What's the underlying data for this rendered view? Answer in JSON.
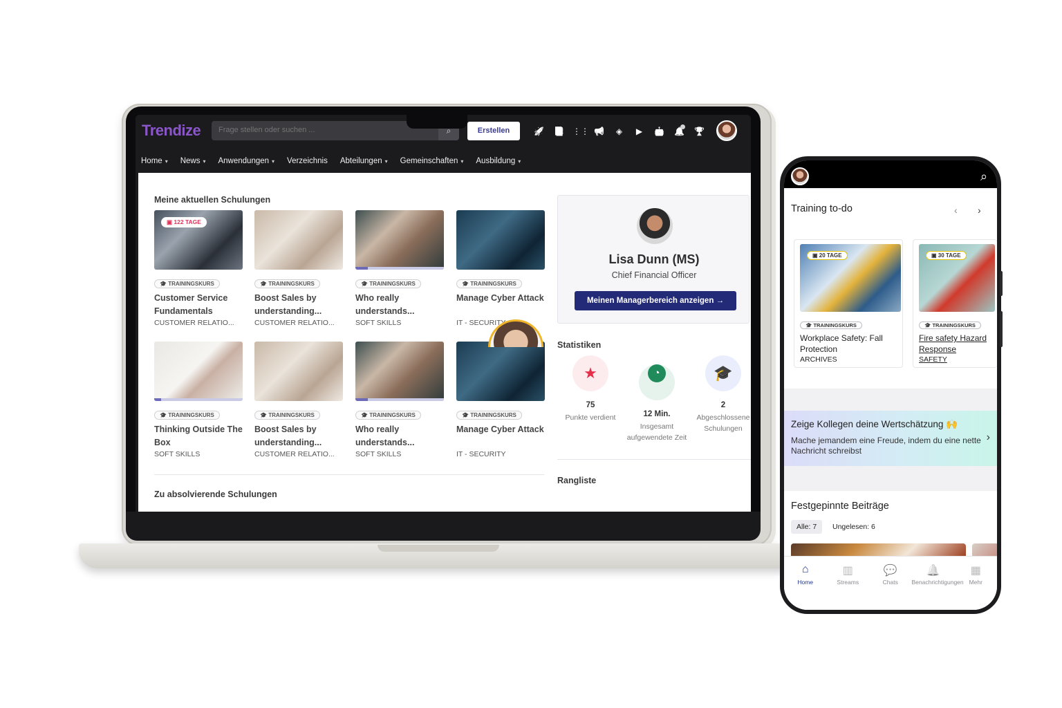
{
  "laptop": {
    "app": {
      "logo_text": "Trendize",
      "search_placeholder": "Frage stellen oder suchen ...",
      "create_label": "Erstellen",
      "top_icons": [
        "rocket-icon",
        "book-icon",
        "apps-grid-icon",
        "megaphone-icon",
        "layers-icon",
        "play-icon",
        "robot-icon",
        "bell-icon",
        "trophy-icon"
      ],
      "nav": [
        {
          "label": "Home",
          "has_dropdown": true
        },
        {
          "label": "News",
          "has_dropdown": true
        },
        {
          "label": "Anwendungen",
          "has_dropdown": true
        },
        {
          "label": "Verzeichnis",
          "has_dropdown": false
        },
        {
          "label": "Abteilungen",
          "has_dropdown": true
        },
        {
          "label": "Gemeinschaften",
          "has_dropdown": true
        },
        {
          "label": "Ausbildung",
          "has_dropdown": true
        }
      ]
    },
    "current_trainings": {
      "title": "Meine aktuellen Schulungen",
      "courses": [
        {
          "badge": "122 TAGE",
          "type": "TRAININGSKURS",
          "title": "Customer Service Fundamentals",
          "category": "CUSTOMER RELATIO...",
          "image": "people",
          "progress": 0
        },
        {
          "type": "TRAININGSKURS",
          "title": "Boost Sales by understanding...",
          "category": "CUSTOMER RELATIO...",
          "image": "shirts",
          "progress": 0
        },
        {
          "type": "TRAININGSKURS",
          "title": "Who really understands...",
          "category": "SOFT SKILLS",
          "image": "selfie",
          "progress": 0.14
        },
        {
          "type": "TRAININGSKURS",
          "title": "Manage Cyber Attack",
          "category": "IT - SECURITY",
          "image": "hacker",
          "progress": 0
        },
        {
          "type": "TRAININGSKURS",
          "title": "Thinking Outside The Box",
          "category": "SOFT SKILLS",
          "image": "thinker",
          "progress": 0.08
        },
        {
          "type": "TRAININGSKURS",
          "title": "Boost Sales by understanding...",
          "category": "CUSTOMER RELATIO...",
          "image": "shirts",
          "progress": 0
        },
        {
          "type": "TRAININGSKURS",
          "title": "Who really understands...",
          "category": "SOFT SKILLS",
          "image": "selfie",
          "progress": 0.14
        },
        {
          "type": "TRAININGSKURS",
          "title": "Manage Cyber Attack",
          "category": "IT - SECURITY",
          "image": "hacker",
          "progress": 0
        }
      ]
    },
    "to_complete": {
      "title": "Zu absolvierende Schulungen"
    },
    "profile": {
      "name": "Lisa Dunn (MS)",
      "role": "Chief Financial Officer",
      "manager_button": "Meinen Managerbereich anzeigen",
      "arrow": "→"
    },
    "stats": {
      "title": "Statistiken",
      "items": [
        {
          "icon": "star-icon",
          "glyph": "★",
          "color": "#e5304a",
          "bg": "#fdecee",
          "value": "75",
          "label": "Punkte verdient"
        },
        {
          "icon": "clock-icon",
          "glyph": "◷",
          "color": "#ffffff",
          "bg": "#e6f3ec",
          "value": "12 Min.",
          "label": "Insgesamt aufgewendete Zeit"
        },
        {
          "icon": "graduation-cap-icon",
          "glyph": "🎓",
          "color": "#2d4fd0",
          "bg": "#eaeefc",
          "value": "2",
          "label": "Abgeschlossene Schulungen"
        }
      ]
    },
    "leaderboard": {
      "title": "Rangliste"
    }
  },
  "phone": {
    "todo": {
      "title": "Training to-do",
      "prev": "‹",
      "next": "›",
      "courses": [
        {
          "badge": "20 TAGE",
          "type": "TRAININGSKURS",
          "title": "Workplace Safety: Fall Protection",
          "category": "ARCHIVES",
          "image": "worker"
        },
        {
          "badge": "30 TAGE",
          "type": "TRAININGSKURS",
          "title": "Fire safety Hazard Response",
          "category": "SAFETY",
          "image": "fire"
        }
      ]
    },
    "appreciation": {
      "title": "Zeige Kollegen deine Wertschätzung 🙌",
      "text": "Mache jemandem eine Freude, indem du eine nette Nachricht schreibst",
      "chevron": "›"
    },
    "pinned": {
      "title": "Festgepinnte Beiträge",
      "filters": [
        {
          "label": "Alle: 7",
          "active": true
        },
        {
          "label": "Ungelesen: 6",
          "active": false
        }
      ]
    },
    "tabs": [
      {
        "label": "Home",
        "icon": "home-icon",
        "glyph": "⌂",
        "active": true
      },
      {
        "label": "Streams",
        "icon": "streams-icon",
        "glyph": "▥",
        "active": false
      },
      {
        "label": "Chats",
        "icon": "chat-icon",
        "glyph": "💬",
        "active": false
      },
      {
        "label": "Benachrichtigungen",
        "icon": "bell-icon",
        "glyph": "🔔",
        "active": false
      },
      {
        "label": "Mehr",
        "icon": "grid-icon",
        "glyph": "▦",
        "active": false
      }
    ]
  }
}
